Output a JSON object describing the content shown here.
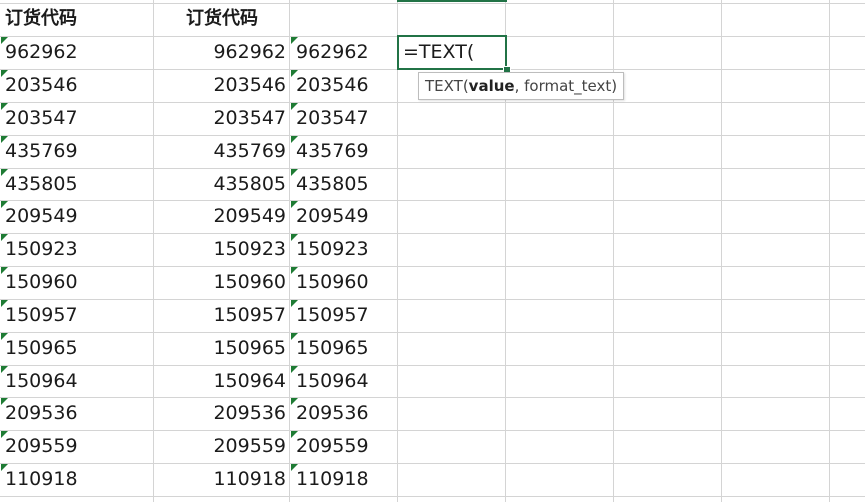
{
  "headers": {
    "col_a": "订货代码",
    "col_b": "订货代码"
  },
  "rows": [
    {
      "a": "962962",
      "b": "962962",
      "c": "962962"
    },
    {
      "a": "203546",
      "b": "203546",
      "c": "203546"
    },
    {
      "a": "203547",
      "b": "203547",
      "c": "203547"
    },
    {
      "a": "435769",
      "b": "435769",
      "c": "435769"
    },
    {
      "a": "435805",
      "b": "435805",
      "c": "435805"
    },
    {
      "a": "209549",
      "b": "209549",
      "c": "209549"
    },
    {
      "a": "150923",
      "b": "150923",
      "c": "150923"
    },
    {
      "a": "150960",
      "b": "150960",
      "c": "150960"
    },
    {
      "a": "150957",
      "b": "150957",
      "c": "150957"
    },
    {
      "a": "150965",
      "b": "150965",
      "c": "150965"
    },
    {
      "a": "150964",
      "b": "150964",
      "c": "150964"
    },
    {
      "a": "209536",
      "b": "209536",
      "c": "209536"
    },
    {
      "a": "209559",
      "b": "209559",
      "c": "209559"
    },
    {
      "a": "110918",
      "b": "110918",
      "c": "110918"
    }
  ],
  "active_cell": {
    "formula": "=TEXT("
  },
  "tooltip": {
    "func": "TEXT(",
    "arg1": "value",
    "rest": ", format_text)"
  },
  "colors": {
    "accent": "#217346",
    "indicator": "#1e7b34",
    "grid": "#d4d4d4"
  }
}
